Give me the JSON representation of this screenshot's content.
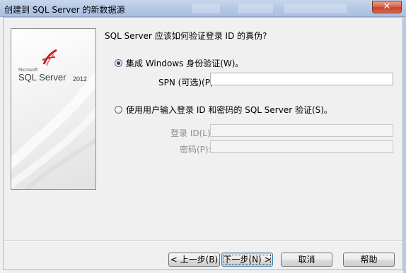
{
  "window": {
    "title": "创建到 SQL Server 的新数据源",
    "close_glyph": "✕"
  },
  "logo": {
    "ms_text": "Microsoft",
    "product": "SQL Server",
    "year": "2012"
  },
  "question": "SQL Server 应该如何验证登录 ID 的真伪?",
  "auth": {
    "windows_label": "集成 Windows 身份验证(W)。",
    "windows_selected": true,
    "spn_label": "SPN (可选)(P):",
    "spn_value": "",
    "sql_label": "使用用户输入登录 ID 和密码的 SQL Server 验证(S)。",
    "sql_selected": false,
    "login_label": "登录 ID(L):",
    "login_value": "",
    "password_label": "密码(P):",
    "password_value": ""
  },
  "buttons": {
    "back": "< 上一步(B)",
    "next": "下一步(N) >",
    "cancel": "取消",
    "help": "帮助"
  }
}
